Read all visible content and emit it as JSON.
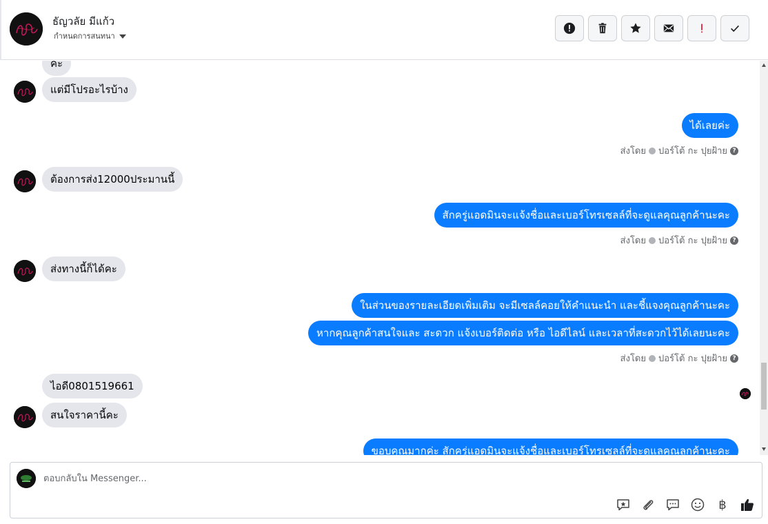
{
  "header": {
    "contact_name": "ธัญวลัย มีแก้ว",
    "assign_label": "กำหนดการสนทนา"
  },
  "actions": [
    {
      "icon": "alert-circle-icon"
    },
    {
      "icon": "trash-icon"
    },
    {
      "icon": "star-icon"
    },
    {
      "icon": "mail-icon"
    },
    {
      "icon": "exclamation-icon",
      "color": "#e41e3f"
    },
    {
      "icon": "check-icon"
    }
  ],
  "messages": {
    "in_0": "ค่ะ",
    "in_1": "แต่มีโปรอะไรบ้าง",
    "out_1": "ได้เลยค่ะ",
    "in_2": "ต้องการส่ง12000ประมานนี้",
    "out_2": "สักครู่แอดมินจะแจ้งชื่อและเบอร์โทรเซลล์ที่จะดูแลคุณลูกค้านะคะ",
    "in_3": "ส่งทางนี้ก็ได้คะ",
    "out_3a": "ในส่วนของรายละเอียดเพิ่มเติม จะมีเซลล์คอยให้คำแนะนำ และชี้แจงคุณลูกค้านะคะ",
    "out_3b": "หากคุณลูกค้าสนใจและ สะดวก แจ้งเบอร์ติดต่อ หรือ ไอดีไลน์ และเวลาที่สะดวกไว้ได้เลยนะคะ",
    "in_4a": "ไอดี0801519661",
    "in_4b": "สนใจราคานี้คะ",
    "out_4": "ขอบคุณมากค่ะ  สักครู่แอดมินจะแจ้งชื่อและเบอร์โทรเซลล์ที่จะดูแลคุณลูกค้านะคะ"
  },
  "meta": {
    "sent_by": "ส่งโดย",
    "sender": "ปอร์โต้ กะ ปุยฝ้าย"
  },
  "composer": {
    "placeholder": "ตอบกลับใน Messenger...",
    "currency_symbol": "฿"
  },
  "colors": {
    "outgoing_bubble": "#0a7cff",
    "incoming_bubble": "#e4e6eb"
  }
}
